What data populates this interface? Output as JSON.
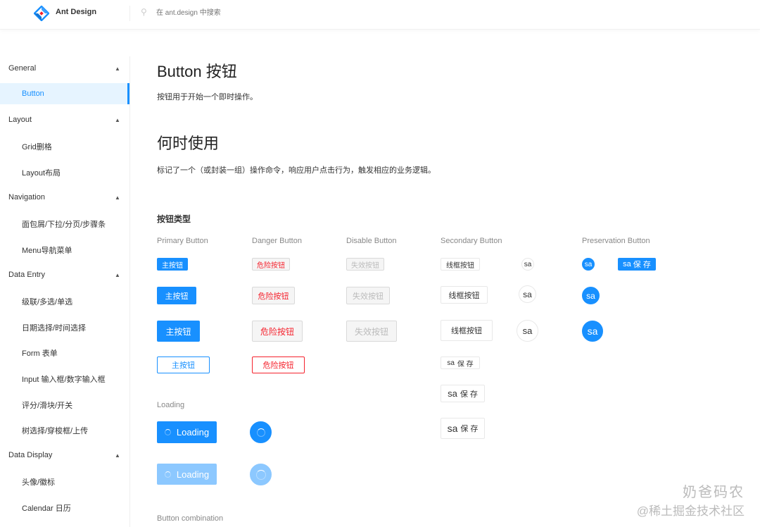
{
  "header": {
    "app_name": "Ant Design",
    "search_placeholder": "在 ant.design 中搜索"
  },
  "sidebar": {
    "groups": [
      {
        "title": "General",
        "items": [
          "Button"
        ]
      },
      {
        "title": "Layout",
        "items": [
          "Grid删格",
          "Layout布局"
        ]
      },
      {
        "title": "Navigation",
        "items": [
          "面包屑/下拉/分页/步骤条",
          "Menu导航菜单"
        ]
      },
      {
        "title": "Data Entry",
        "items": [
          "级联/多选/单选",
          "日期选择/时间选择",
          "Form 表单",
          "Input 输入框/数字输入框",
          "评分/滑块/开关",
          "树选择/穿梭框/上传"
        ]
      },
      {
        "title": "Data Display",
        "items": [
          "头像/徽标",
          "Calendar 日历"
        ]
      }
    ],
    "active_item": "Button"
  },
  "main": {
    "title": "Button  按钮",
    "description": "按钮用于开始一个即时操作。",
    "when_title": "何时使用",
    "when_description": "标记了一个（或封装一组）操作命令，响应用户点击行为，触发相应的业务逻辑。",
    "types_title": "按钮类型",
    "columns": {
      "primary": "Primary Button",
      "danger": "Danger Button",
      "disable": "Disable Button",
      "secondary": "Secondary Button",
      "preservation": "Preservation Button"
    },
    "labels": {
      "primary": "主按钮",
      "danger": "危险按钮",
      "disabled": "失效按钮",
      "outline": "线框按钮",
      "sa": "sa",
      "save": "保 存"
    },
    "loading_title": "Loading",
    "loading_label": "Loading",
    "combination_title": "Button combination"
  },
  "watermark": {
    "line1": "奶爸码农",
    "line2": "@稀土掘金技术社区"
  },
  "colors": {
    "primary": "#1890ff",
    "danger": "#f5222d"
  }
}
